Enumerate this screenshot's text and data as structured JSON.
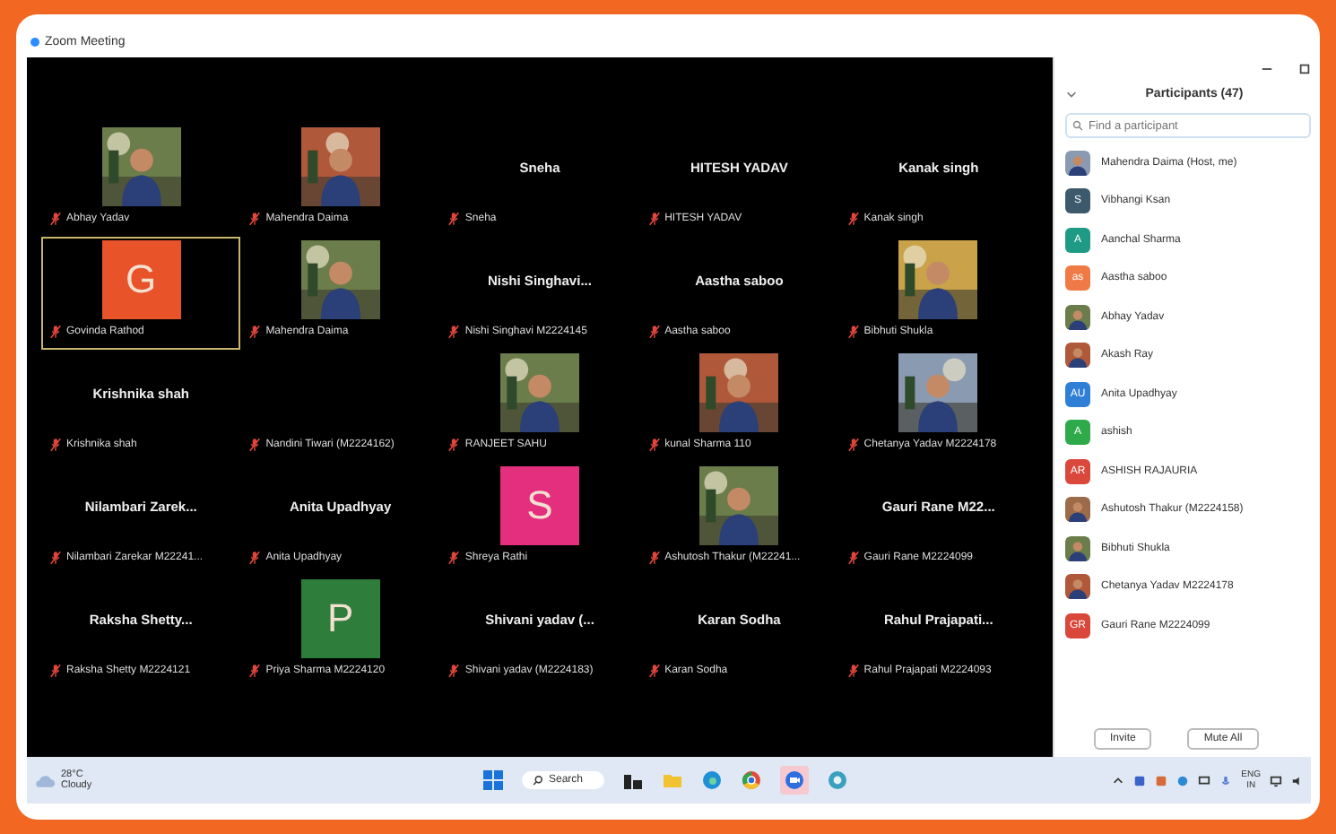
{
  "window": {
    "title": "Zoom Meeting"
  },
  "gallery": [
    {
      "label": "Abhay Yadav",
      "active_speaker": false
    },
    {
      "label": "Mahendra Daima",
      "active_speaker": false
    },
    {
      "kind": "name",
      "display": "Sneha",
      "label": "Sneha",
      "active_speaker": false
    },
    {
      "kind": "name",
      "display": "HITESH YADAV",
      "label": "HITESH YADAV",
      "active_speaker": false
    },
    {
      "kind": "name",
      "display": "Kanak singh",
      "label": "Kanak singh",
      "active_speaker": false
    },
    {
      "kind": "initial",
      "initial": "G",
      "color": "#e8532a",
      "label": "Govinda Rathod",
      "active_speaker": true
    },
    {
      "label": "Mahendra Daima",
      "active_speaker": false
    },
    {
      "kind": "name",
      "display": "Nishi Singhavi...",
      "label": "Nishi Singhavi M2224145",
      "active_speaker": false
    },
    {
      "kind": "name",
      "display": "Aastha saboo",
      "label": "Aastha saboo",
      "active_speaker": false
    },
    {
      "label": "Bibhuti Shukla",
      "active_speaker": false
    },
    {
      "kind": "name",
      "display": "Krishnika shah",
      "label": "Krishnika shah",
      "active_speaker": false
    },
    {
      "kind": "blank",
      "label": "Nandini Tiwari (M2224162)",
      "active_speaker": false
    },
    {
      "label": "RANJEET SAHU",
      "active_speaker": false
    },
    {
      "label": "kunal Sharma 110",
      "active_speaker": false
    },
    {
      "label": "Chetanya Yadav M2224178",
      "active_speaker": false
    },
    {
      "kind": "name",
      "display": "Nilambari Zarek...",
      "label": "Nilambari Zarekar M22241...",
      "active_speaker": false
    },
    {
      "kind": "name",
      "display": "Anita Upadhyay",
      "label": "Anita Upadhyay",
      "active_speaker": false
    },
    {
      "kind": "initial",
      "initial": "S",
      "color": "#e42f7e",
      "label": "Shreya Rathi",
      "active_speaker": false
    },
    {
      "label": "Ashutosh Thakur (M22241...",
      "active_speaker": false
    },
    {
      "kind": "name",
      "display": "Gauri Rane M22...",
      "label": "Gauri Rane M2224099",
      "active_speaker": false
    },
    {
      "kind": "name",
      "display": "Raksha Shetty...",
      "label": "Raksha Shetty M2224121",
      "active_speaker": false
    },
    {
      "kind": "initial",
      "initial": "P",
      "color": "#2e7d3a",
      "label": "Priya Sharma M2224120",
      "active_speaker": false
    },
    {
      "kind": "name",
      "display": "Shivani yadav (...",
      "label": "Shivani yadav (M2224183)",
      "active_speaker": false
    },
    {
      "kind": "name",
      "display": "Karan Sodha",
      "label": "Karan Sodha",
      "active_speaker": false
    },
    {
      "kind": "name",
      "display": "Rahul Prajapati...",
      "label": "Rahul Prajapati M2224093",
      "active_speaker": false
    }
  ],
  "participants": {
    "title": "Participants (47)",
    "search": {
      "placeholder": "Find a participant"
    },
    "items": [
      {
        "name": "Mahendra Daima (Host, me)"
      },
      {
        "kind": "initial",
        "initial": "S",
        "color": "#3d5a6c",
        "name": "Vibhangi Ksan"
      },
      {
        "kind": "initial",
        "initial": "A",
        "color": "#1e9a85",
        "name": "Aanchal Sharma"
      },
      {
        "kind": "initial",
        "initial": "as",
        "color": "#ef7a45",
        "name": "Aastha saboo"
      },
      {
        "name": "Abhay Yadav"
      },
      {
        "name": "Akash Ray"
      },
      {
        "kind": "initial",
        "initial": "AU",
        "color": "#2f7fd6",
        "name": "Anita Upadhyay"
      },
      {
        "kind": "initial",
        "initial": "A",
        "color": "#2eaa4a",
        "name": "ashish"
      },
      {
        "kind": "initial",
        "initial": "AR",
        "color": "#d9483b",
        "name": "ASHISH RAJAURIA"
      },
      {
        "name": "Ashutosh Thakur (M2224158)"
      },
      {
        "name": "Bibhuti Shukla"
      },
      {
        "name": "Chetanya Yadav  M2224178"
      },
      {
        "kind": "initial",
        "initial": "GR",
        "color": "#d9483b",
        "name": "Gauri Rane M2224099"
      }
    ],
    "buttons": [
      "Invite",
      "Mute All"
    ]
  },
  "taskbar": {
    "weather": {
      "temp": "28°C",
      "condition": "Cloudy"
    },
    "search": "Search",
    "language": "ENG",
    "region": "IN"
  }
}
